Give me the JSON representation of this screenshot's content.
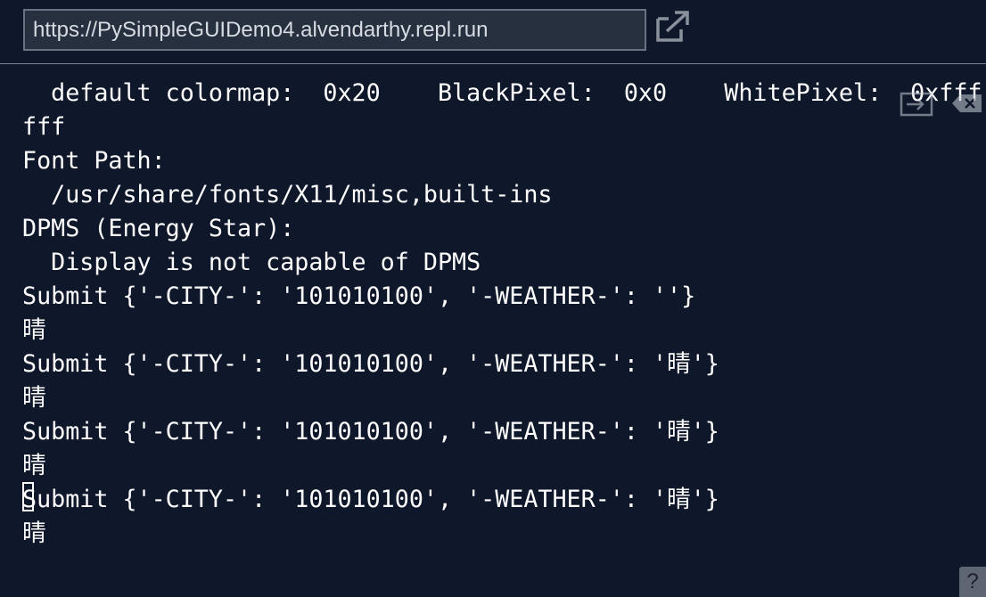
{
  "header": {
    "url": "https://PySimpleGUIDemo4.alvendarthy.repl.run",
    "open_icon": "external-link-icon"
  },
  "terminal": {
    "lines": [
      "  default colormap:  0x20    BlackPixel:  0x0    WhitePixel:  0xfff",
      "fff",
      "Font Path:",
      "  /usr/share/fonts/X11/misc,built-ins",
      "DPMS (Energy Star):",
      "  Display is not capable of DPMS",
      "Submit {'-CITY-': '101010100', '-WEATHER-': ''}",
      "晴",
      "Submit {'-CITY-': '101010100', '-WEATHER-': '晴'}",
      "晴",
      "Submit {'-CITY-': '101010100', '-WEATHER-': '晴'}",
      "晴",
      "Submit {'-CITY-': '101010100', '-WEATHER-': '晴'}",
      "晴"
    ]
  },
  "overlay": {
    "screen_icon": "display-icon",
    "clear_icon": "clear-icon",
    "help_label": "?"
  },
  "colors": {
    "background": "#0f172a",
    "url_bar": "#27303f",
    "text": "#ffffff"
  }
}
